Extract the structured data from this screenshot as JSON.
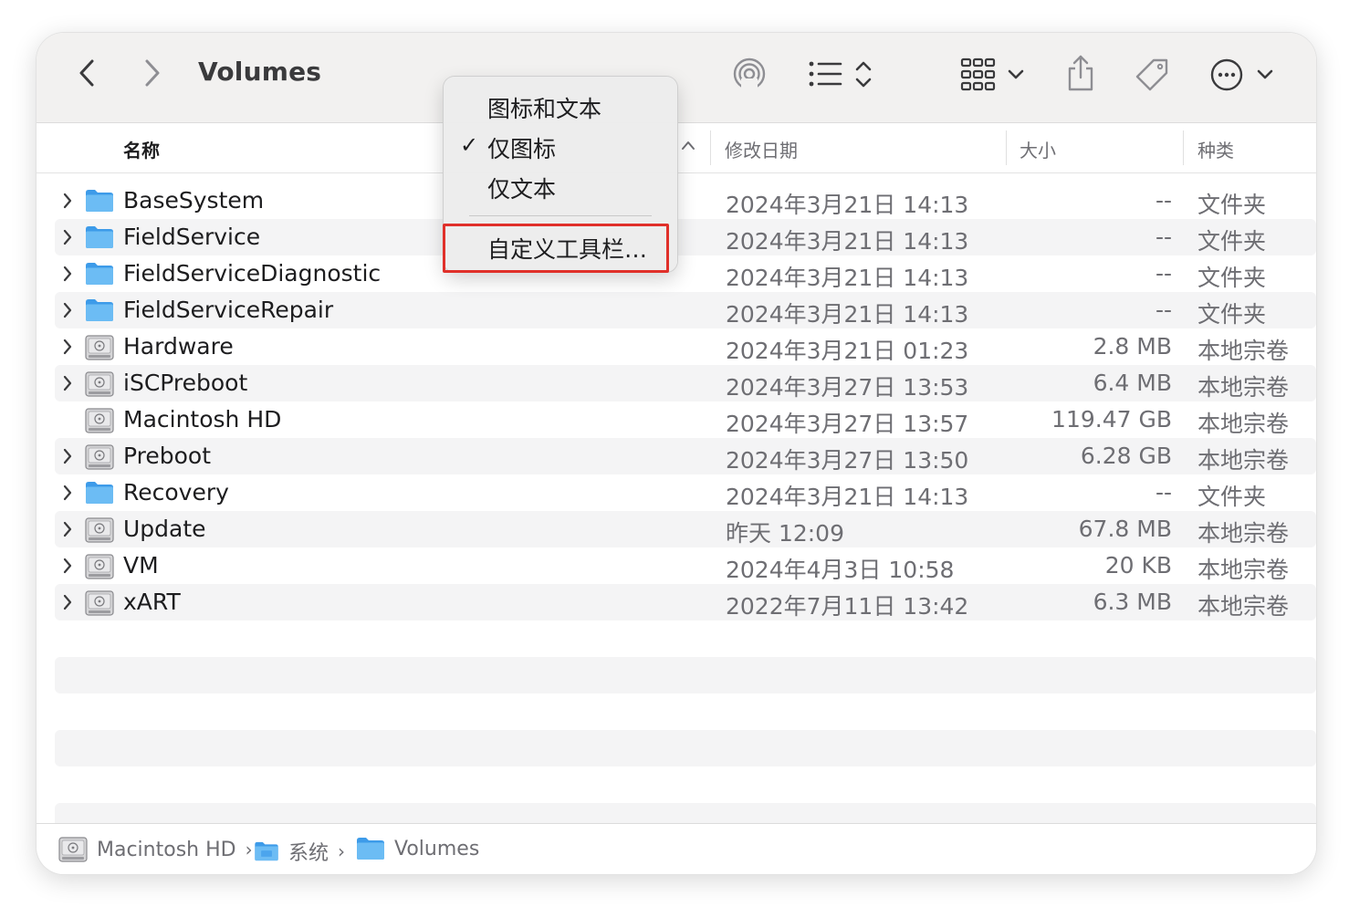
{
  "window": {
    "title": "Volumes"
  },
  "toolbar": {
    "back_icon": "chevron-left-icon",
    "forward_icon": "chevron-right-icon",
    "airdrop_icon": "airdrop-icon",
    "view_icon": "list-view-icon",
    "group_icon": "grid-group-icon",
    "share_icon": "share-icon",
    "tag_icon": "tag-icon",
    "more_icon": "ellipsis-circle-icon"
  },
  "columns": {
    "name": "名称",
    "date": "修改日期",
    "size": "大小",
    "kind": "种类"
  },
  "files": [
    {
      "name": "BaseSystem",
      "date": "2024年3月21日 14:13",
      "size": "--",
      "kind": "文件夹",
      "icon": "folder-icon",
      "expandable": true
    },
    {
      "name": "FieldService",
      "date": "2024年3月21日 14:13",
      "size": "--",
      "kind": "文件夹",
      "icon": "folder-icon",
      "expandable": true
    },
    {
      "name": "FieldServiceDiagnostic",
      "date": "2024年3月21日 14:13",
      "size": "--",
      "kind": "文件夹",
      "icon": "folder-icon",
      "expandable": true
    },
    {
      "name": "FieldServiceRepair",
      "date": "2024年3月21日 14:13",
      "size": "--",
      "kind": "文件夹",
      "icon": "folder-icon",
      "expandable": true
    },
    {
      "name": "Hardware",
      "date": "2024年3月21日 01:23",
      "size": "2.8 MB",
      "kind": "本地宗卷",
      "icon": "disk-icon",
      "expandable": true
    },
    {
      "name": "iSCPreboot",
      "date": "2024年3月27日 13:53",
      "size": "6.4 MB",
      "kind": "本地宗卷",
      "icon": "disk-icon",
      "expandable": true
    },
    {
      "name": "Macintosh HD",
      "date": "2024年3月27日 13:57",
      "size": "119.47 GB",
      "kind": "本地宗卷",
      "icon": "disk-icon",
      "expandable": false
    },
    {
      "name": "Preboot",
      "date": "2024年3月27日 13:50",
      "size": "6.28 GB",
      "kind": "本地宗卷",
      "icon": "disk-icon",
      "expandable": true
    },
    {
      "name": "Recovery",
      "date": "2024年3月21日 14:13",
      "size": "--",
      "kind": "文件夹",
      "icon": "folder-icon",
      "expandable": true
    },
    {
      "name": "Update",
      "date": "昨天 12:09",
      "size": "67.8 MB",
      "kind": "本地宗卷",
      "icon": "disk-icon",
      "expandable": true
    },
    {
      "name": "VM",
      "date": "2024年4月3日 10:58",
      "size": "20 KB",
      "kind": "本地宗卷",
      "icon": "disk-icon",
      "expandable": true
    },
    {
      "name": "xART",
      "date": "2022年7月11日 13:42",
      "size": "6.3 MB",
      "kind": "本地宗卷",
      "icon": "disk-icon",
      "expandable": true
    }
  ],
  "context_menu": {
    "items": [
      {
        "label": "图标和文本",
        "checked": false
      },
      {
        "label": "仅图标",
        "checked": true
      },
      {
        "label": "仅文本",
        "checked": false
      }
    ],
    "customize_label": "自定义工具栏…",
    "check_mark": "✓"
  },
  "pathbar": {
    "crumbs": [
      {
        "label": "Macintosh HD",
        "icon": "disk-icon"
      },
      {
        "label": "系统",
        "icon": "system-folder-icon"
      },
      {
        "label": "Volumes",
        "icon": "folder-icon"
      }
    ],
    "separator": "›"
  },
  "colors": {
    "highlight_box": "#e0302a",
    "folder": "#5db1ef"
  }
}
